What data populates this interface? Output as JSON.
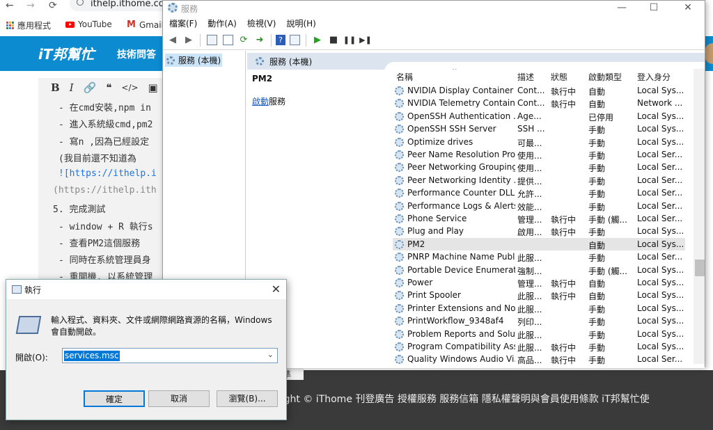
{
  "browser": {
    "nav": {
      "back": "←",
      "forward": "→",
      "reload": "C"
    },
    "url": "ithelp.ithome.com",
    "bookmarks": [
      {
        "label": "應用程式",
        "icon": "apps-grid-icon"
      },
      {
        "label": "YouTube",
        "icon": "youtube-icon"
      },
      {
        "label": "Gmail",
        "icon": "gmail-icon"
      }
    ]
  },
  "ithome": {
    "logo": "iT邦幫忙",
    "nav_item": "技術問答",
    "editor_toolbar": [
      "B",
      "I",
      "🔗",
      "❝",
      "</>",
      "▣"
    ],
    "lines": [
      "- 在cmd安裝,npm in",
      "- 進入系統級cmd,pm2",
      "- 寫n ,因為已經設定",
      "  (我目前還不知道為",
      "![https://ithelp.i",
      "(https://ithelp.ith",
      "5. 完成測試",
      "- window + R 執行s",
      "- 查看PM2這個服務",
      "- 同時在系統管理員身",
      "- 重開機, 以系統管理"
    ],
    "footer_tab": "準",
    "footer": "right © iThome   刊登廣告   授權服務   服務信箱   隱私權聲明與會員使用條款   iT邦幫忙使"
  },
  "services": {
    "title": "服務",
    "menu": [
      "檔案(F)",
      "動作(A)",
      "檢視(V)",
      "說明(H)"
    ],
    "tree_item": "服務 (本機)",
    "header": "服務 (本機)",
    "selected_name": "PM2",
    "start_link": "啟動",
    "start_suffix": "服務",
    "columns": [
      "名稱",
      "描述",
      "狀態",
      "啟動類型",
      "登入身分"
    ],
    "rows": [
      {
        "name": "NVIDIA Display Container LS",
        "desc": "Cont...",
        "status": "執行中",
        "startup": "自動",
        "logon": "Local Sys..."
      },
      {
        "name": "NVIDIA Telemetry Container",
        "desc": "Cont...",
        "status": "執行中",
        "startup": "自動",
        "logon": "Network ..."
      },
      {
        "name": "OpenSSH Authentication ...",
        "desc": "Age...",
        "status": "",
        "startup": "已停用",
        "logon": "Local Sys..."
      },
      {
        "name": "OpenSSH SSH Server",
        "desc": "SSH ...",
        "status": "",
        "startup": "手動",
        "logon": "Local Sys..."
      },
      {
        "name": "Optimize drives",
        "desc": "可最...",
        "status": "",
        "startup": "手動",
        "logon": "Local Sys..."
      },
      {
        "name": "Peer Name Resolution Prot...",
        "desc": "使用...",
        "status": "",
        "startup": "手動",
        "logon": "Local Ser..."
      },
      {
        "name": "Peer Networking Grouping",
        "desc": "使用...",
        "status": "",
        "startup": "手動",
        "logon": "Local Ser..."
      },
      {
        "name": "Peer Networking Identity ...",
        "desc": "提供...",
        "status": "",
        "startup": "手動",
        "logon": "Local Ser..."
      },
      {
        "name": "Performance Counter DLL ...",
        "desc": "允許...",
        "status": "",
        "startup": "手動",
        "logon": "Local Ser..."
      },
      {
        "name": "Performance Logs & Alerts",
        "desc": "效能...",
        "status": "",
        "startup": "手動",
        "logon": "Local Ser..."
      },
      {
        "name": "Phone Service",
        "desc": "管理...",
        "status": "執行中",
        "startup": "手動 (觸...",
        "logon": "Local Ser..."
      },
      {
        "name": "Plug and Play",
        "desc": "啟用...",
        "status": "執行中",
        "startup": "手動",
        "logon": "Local Sys..."
      },
      {
        "name": "PM2",
        "desc": "",
        "status": "",
        "startup": "自動",
        "logon": "Local Sys..."
      },
      {
        "name": "PNRP Machine Name Publi...",
        "desc": "此服...",
        "status": "",
        "startup": "手動",
        "logon": "Local Ser..."
      },
      {
        "name": "Portable Device Enumerat...",
        "desc": "強制...",
        "status": "",
        "startup": "手動 (觸...",
        "logon": "Local Sys..."
      },
      {
        "name": "Power",
        "desc": "管理...",
        "status": "執行中",
        "startup": "自動",
        "logon": "Local Sys..."
      },
      {
        "name": "Print Spooler",
        "desc": "此服...",
        "status": "執行中",
        "startup": "自動",
        "logon": "Local Sys..."
      },
      {
        "name": "Printer Extensions and Noti...",
        "desc": "此服...",
        "status": "",
        "startup": "手動",
        "logon": "Local Sys..."
      },
      {
        "name": "PrintWorkflow_9348af4",
        "desc": "列印...",
        "status": "",
        "startup": "手動",
        "logon": "Local Sys..."
      },
      {
        "name": "Problem Reports and Soluti...",
        "desc": "此服...",
        "status": "",
        "startup": "手動",
        "logon": "Local Sys..."
      },
      {
        "name": "Program Compatibility Assi...",
        "desc": "此服...",
        "status": "執行中",
        "startup": "手動",
        "logon": "Local Sys..."
      },
      {
        "name": "Quality Windows Audio Vi...",
        "desc": "高品...",
        "status": "執行中",
        "startup": "手動",
        "logon": "Local Ser..."
      }
    ],
    "selected_index": 12
  },
  "run_dialog": {
    "title": "執行",
    "message": "輸入程式、資料夾、文件或網際網路資源的名稱，Windows 會自動開啟。",
    "open_label": "開啟(O):",
    "input_value": "services.msc",
    "buttons": {
      "ok": "確定",
      "cancel": "取消",
      "browse": "瀏覽(B)..."
    }
  }
}
